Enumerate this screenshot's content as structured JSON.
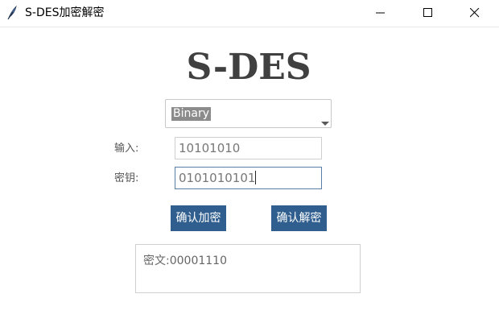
{
  "window": {
    "title": "S-DES加密解密"
  },
  "main": {
    "heading": "S-DES",
    "mode_select": {
      "selected": "Binary"
    },
    "input_label": "输入:",
    "input_value": "10101010",
    "key_label": "密钥:",
    "key_value": "0101010101",
    "encrypt_button": "确认加密",
    "decrypt_button": "确认解密",
    "output_label": "密文:",
    "output_value": "00001110"
  },
  "icons": {
    "app": "feather-icon",
    "minimize": "minimize-icon",
    "maximize": "maximize-icon",
    "close": "close-icon",
    "dropdown": "chevron-down-icon"
  },
  "colors": {
    "button_bg": "#305f8f",
    "heading": "#404040",
    "selected_bg": "#8b8b8b",
    "focus_border": "#5a7ea8"
  }
}
